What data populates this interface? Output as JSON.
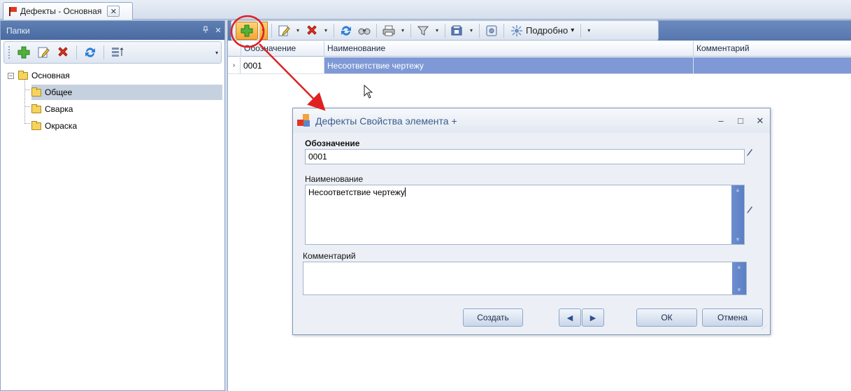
{
  "tab": {
    "title": "Дефекты - Основная",
    "close_symbol": "✕"
  },
  "folders_panel": {
    "title": "Папки",
    "pin_symbol": "ꟷ",
    "close_symbol": "✕",
    "tree": {
      "root": {
        "label": "Основная",
        "expander": "−"
      },
      "children": [
        {
          "label": "Общее",
          "selected": true
        },
        {
          "label": "Сварка",
          "selected": false
        },
        {
          "label": "Окраска",
          "selected": false
        }
      ]
    }
  },
  "main_toolbar": {
    "detailed_label": "Подробно",
    "caret": "▾"
  },
  "grid": {
    "columns": [
      "Обозначение",
      "Наименование",
      "Комментарий"
    ],
    "rows": [
      {
        "indicator": "›",
        "code": "0001",
        "name": "Несоответствие чертежу",
        "comment": ""
      }
    ]
  },
  "dialog": {
    "title": "Дефекты Свойства элемента +",
    "minimize_symbol": "–",
    "maximize_symbol": "□",
    "close_symbol": "✕",
    "fields": {
      "code": {
        "label": "Обозначение",
        "value": "0001"
      },
      "name": {
        "label": "Наименование",
        "value": "Несоответствие чертежу"
      },
      "comment": {
        "label": "Комментарий",
        "value": ""
      }
    },
    "buttons": {
      "create": "Создать",
      "prev": "◀",
      "next": "▶",
      "ok": "ОК",
      "cancel": "Отмена"
    }
  },
  "colors": {
    "annotation": "#e02020",
    "selection": "#7f99d6",
    "header_blue": "#5677ae"
  }
}
